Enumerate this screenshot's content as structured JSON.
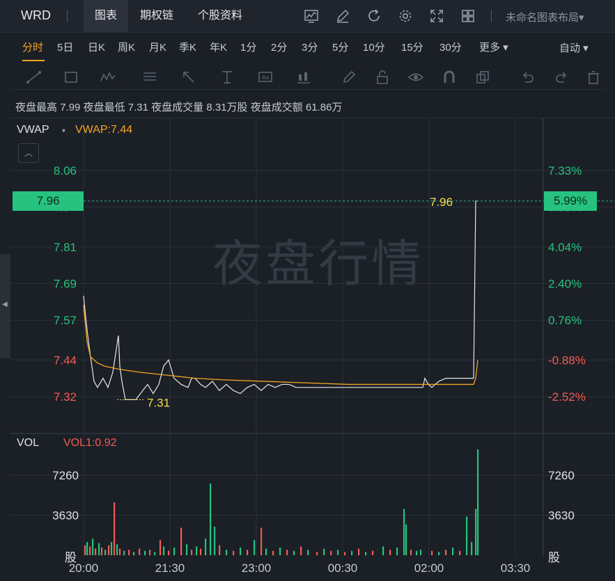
{
  "topbar": {
    "ticker": "WRD",
    "tabs": [
      "图表",
      "期权链",
      "个股资料"
    ],
    "active_tab": "图表",
    "icons": [
      "line-chart-settings-icon",
      "pen-icon",
      "refresh-icon",
      "gear-icon",
      "fullscreen-icon",
      "grid-layout-icon"
    ],
    "layout_name": "未命名图表布局",
    "layout_arrow": "▾"
  },
  "periods": {
    "items": [
      "分时",
      "5日",
      "日K",
      "周K",
      "月K",
      "季K",
      "年K",
      "1分",
      "2分",
      "3分",
      "5分",
      "10分",
      "15分",
      "30分",
      "更多 ▾"
    ],
    "active": "分时",
    "auto_label": "自动  ▾"
  },
  "drawtools": [
    "trendline-icon",
    "rectangle-icon",
    "wave-icon",
    "fibonacci-icon",
    "arrow-icon",
    "text-measure-icon",
    "text-label-icon",
    "candle-tool-icon",
    "pencil-icon",
    "lock-icon",
    "eye-icon",
    "magnet-icon",
    "copy-icon",
    "undo-icon",
    "redo-icon",
    "trash-icon"
  ],
  "stats": {
    "night_high_label": "夜盘最高",
    "night_high": "7.99",
    "night_low_label": "夜盘最低",
    "night_low": "7.31",
    "night_vol_label": "夜盘成交量",
    "night_vol": "8.31万股",
    "night_amt_label": "夜盘成交额",
    "night_amt": "61.86万"
  },
  "watermark": "夜盘行情",
  "indicator": {
    "name": "VWAP",
    "arrow": "▾",
    "value": "VWAP:7.44"
  },
  "price_flag": "7.96",
  "pct_flag": "5.99%",
  "volume": {
    "name": "VOL",
    "value": "VOL1:0.92",
    "unit": "股",
    "ticks": [
      "7260",
      "3630"
    ]
  },
  "colors": {
    "up": "#27c27f",
    "down": "#f25c54",
    "accent": "#f5a623",
    "price_line": "#e8e8e8"
  },
  "chart_data": {
    "type": "line",
    "price_ticks_left": [
      "8.06",
      "7.94",
      "7.81",
      "7.69",
      "7.57",
      "7.44",
      "7.32"
    ],
    "price_ticks_right": [
      "7.33%",
      "6.08%",
      "4.04%",
      "2.40%",
      "0.76%",
      "-0.88%",
      "-2.52%"
    ],
    "x_ticks": [
      "20:00",
      "21:30",
      "23:00",
      "00:30",
      "02:00",
      "03:30"
    ],
    "annotations": {
      "high": "7.96",
      "low": "7.31"
    },
    "price_x": [
      0,
      3,
      6,
      10,
      15,
      20,
      28,
      35,
      42,
      50,
      52,
      55,
      60,
      68,
      75,
      85,
      92,
      100,
      108,
      115,
      122,
      130,
      140,
      150,
      155,
      160,
      168,
      175,
      185,
      195,
      205,
      215,
      225,
      235,
      245,
      255,
      265,
      275,
      285,
      295,
      305,
      315,
      330,
      345,
      360,
      370,
      380,
      395,
      400,
      410,
      420,
      440,
      460,
      470,
      480,
      487,
      490,
      495,
      500,
      505,
      510,
      520,
      535,
      550,
      560,
      563,
      566
    ],
    "price_y": [
      7.65,
      7.58,
      7.52,
      7.45,
      7.37,
      7.35,
      7.38,
      7.35,
      7.4,
      7.52,
      7.42,
      7.37,
      7.31,
      7.31,
      7.31,
      7.34,
      7.36,
      7.33,
      7.36,
      7.42,
      7.44,
      7.38,
      7.36,
      7.35,
      7.38,
      7.38,
      7.36,
      7.35,
      7.37,
      7.34,
      7.36,
      7.34,
      7.33,
      7.35,
      7.36,
      7.34,
      7.36,
      7.35,
      7.36,
      7.36,
      7.35,
      7.35,
      7.35,
      7.35,
      7.35,
      7.35,
      7.35,
      7.35,
      7.35,
      7.35,
      7.35,
      7.35,
      7.35,
      7.35,
      7.35,
      7.35,
      7.38,
      7.36,
      7.35,
      7.36,
      7.37,
      7.38,
      7.38,
      7.38,
      7.38,
      7.96,
      7.96
    ],
    "vwap_x": [
      0,
      5,
      10,
      20,
      30,
      50,
      80,
      120,
      160,
      200,
      260,
      320,
      380,
      440,
      500,
      540,
      560,
      563,
      566
    ],
    "vwap_y": [
      7.62,
      7.5,
      7.45,
      7.43,
      7.42,
      7.41,
      7.4,
      7.39,
      7.38,
      7.375,
      7.37,
      7.365,
      7.36,
      7.36,
      7.36,
      7.36,
      7.36,
      7.38,
      7.44
    ],
    "volume_bars": [
      [
        2,
        900,
        1
      ],
      [
        5,
        1200,
        0
      ],
      [
        9,
        800,
        1
      ],
      [
        13,
        1500,
        0
      ],
      [
        17,
        600,
        1
      ],
      [
        22,
        1100,
        0
      ],
      [
        26,
        700,
        1
      ],
      [
        31,
        500,
        0
      ],
      [
        36,
        900,
        1
      ],
      [
        40,
        1200,
        0
      ],
      [
        44,
        4800,
        1
      ],
      [
        48,
        1000,
        0
      ],
      [
        52,
        600,
        1
      ],
      [
        58,
        400,
        0
      ],
      [
        65,
        500,
        1
      ],
      [
        72,
        300,
        0
      ],
      [
        80,
        600,
        1
      ],
      [
        88,
        400,
        0
      ],
      [
        95,
        500,
        1
      ],
      [
        102,
        300,
        0
      ],
      [
        110,
        1400,
        1
      ],
      [
        115,
        800,
        0
      ],
      [
        122,
        400,
        1
      ],
      [
        130,
        700,
        0
      ],
      [
        140,
        2500,
        1
      ],
      [
        148,
        1000,
        0
      ],
      [
        155,
        500,
        1
      ],
      [
        162,
        800,
        0
      ],
      [
        168,
        600,
        1
      ],
      [
        175,
        1500,
        0
      ],
      [
        182,
        6500,
        0
      ],
      [
        188,
        2600,
        0
      ],
      [
        195,
        900,
        1
      ],
      [
        205,
        500,
        0
      ],
      [
        215,
        400,
        1
      ],
      [
        225,
        700,
        0
      ],
      [
        235,
        500,
        1
      ],
      [
        245,
        1400,
        0
      ],
      [
        255,
        2500,
        1
      ],
      [
        262,
        600,
        0
      ],
      [
        272,
        400,
        1
      ],
      [
        282,
        700,
        0
      ],
      [
        292,
        500,
        1
      ],
      [
        302,
        400,
        0
      ],
      [
        312,
        800,
        1
      ],
      [
        322,
        500,
        0
      ],
      [
        335,
        300,
        1
      ],
      [
        345,
        600,
        0
      ],
      [
        355,
        400,
        1
      ],
      [
        365,
        500,
        0
      ],
      [
        375,
        300,
        1
      ],
      [
        385,
        400,
        0
      ],
      [
        395,
        600,
        1
      ],
      [
        405,
        300,
        0
      ],
      [
        415,
        400,
        1
      ],
      [
        430,
        800,
        0
      ],
      [
        440,
        500,
        1
      ],
      [
        450,
        700,
        0
      ],
      [
        460,
        4200,
        0
      ],
      [
        463,
        2800,
        0
      ],
      [
        470,
        500,
        1
      ],
      [
        478,
        400,
        0
      ],
      [
        484,
        500,
        0
      ],
      [
        500,
        400,
        1
      ],
      [
        510,
        300,
        0
      ],
      [
        520,
        500,
        1
      ],
      [
        530,
        700,
        0
      ],
      [
        540,
        400,
        1
      ],
      [
        550,
        3500,
        0
      ],
      [
        557,
        1200,
        0
      ],
      [
        563,
        4200,
        0
      ],
      [
        566,
        9600,
        0
      ]
    ]
  }
}
